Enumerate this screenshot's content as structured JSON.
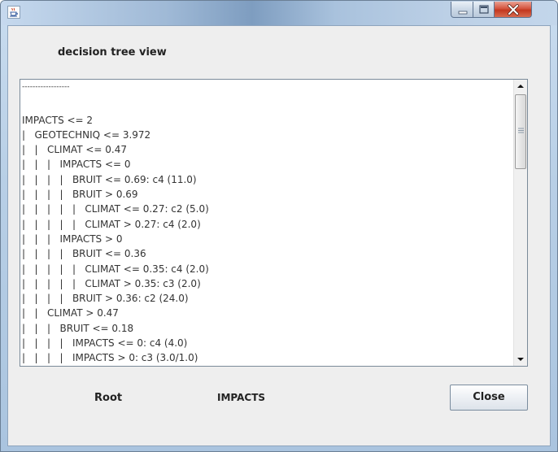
{
  "window": {
    "title": "",
    "app_icon": "java-coffee-cup-icon",
    "controls": [
      "minimize-icon",
      "maximize-icon",
      "close-icon"
    ],
    "close_color": "#c8442e"
  },
  "heading": "decision tree view",
  "tree": {
    "lines": [
      "------------------",
      "",
      "IMPACTS <= 2",
      "|   GEOTECHNIQ <= 3.972",
      "|   |   CLIMAT <= 0.47",
      "|   |   |   IMPACTS <= 0",
      "|   |   |   |   BRUIT <= 0.69: c4 (11.0)",
      "|   |   |   |   BRUIT > 0.69",
      "|   |   |   |   |   CLIMAT <= 0.27: c2 (5.0)",
      "|   |   |   |   |   CLIMAT > 0.27: c4 (2.0)",
      "|   |   |   IMPACTS > 0",
      "|   |   |   |   BRUIT <= 0.36",
      "|   |   |   |   |   CLIMAT <= 0.35: c4 (2.0)",
      "|   |   |   |   |   CLIMAT > 0.35: c3 (2.0)",
      "|   |   |   |   BRUIT > 0.36: c2 (24.0)",
      "|   |   CLIMAT > 0.47",
      "|   |   |   BRUIT <= 0.18",
      "|   |   |   |   IMPACTS <= 0: c4 (4.0)",
      "|   |   |   |   IMPACTS > 0: c3 (3.0/1.0)"
    ]
  },
  "footer": {
    "root_label": "Root",
    "root_value": "IMPACTS",
    "close_button": "Close"
  }
}
